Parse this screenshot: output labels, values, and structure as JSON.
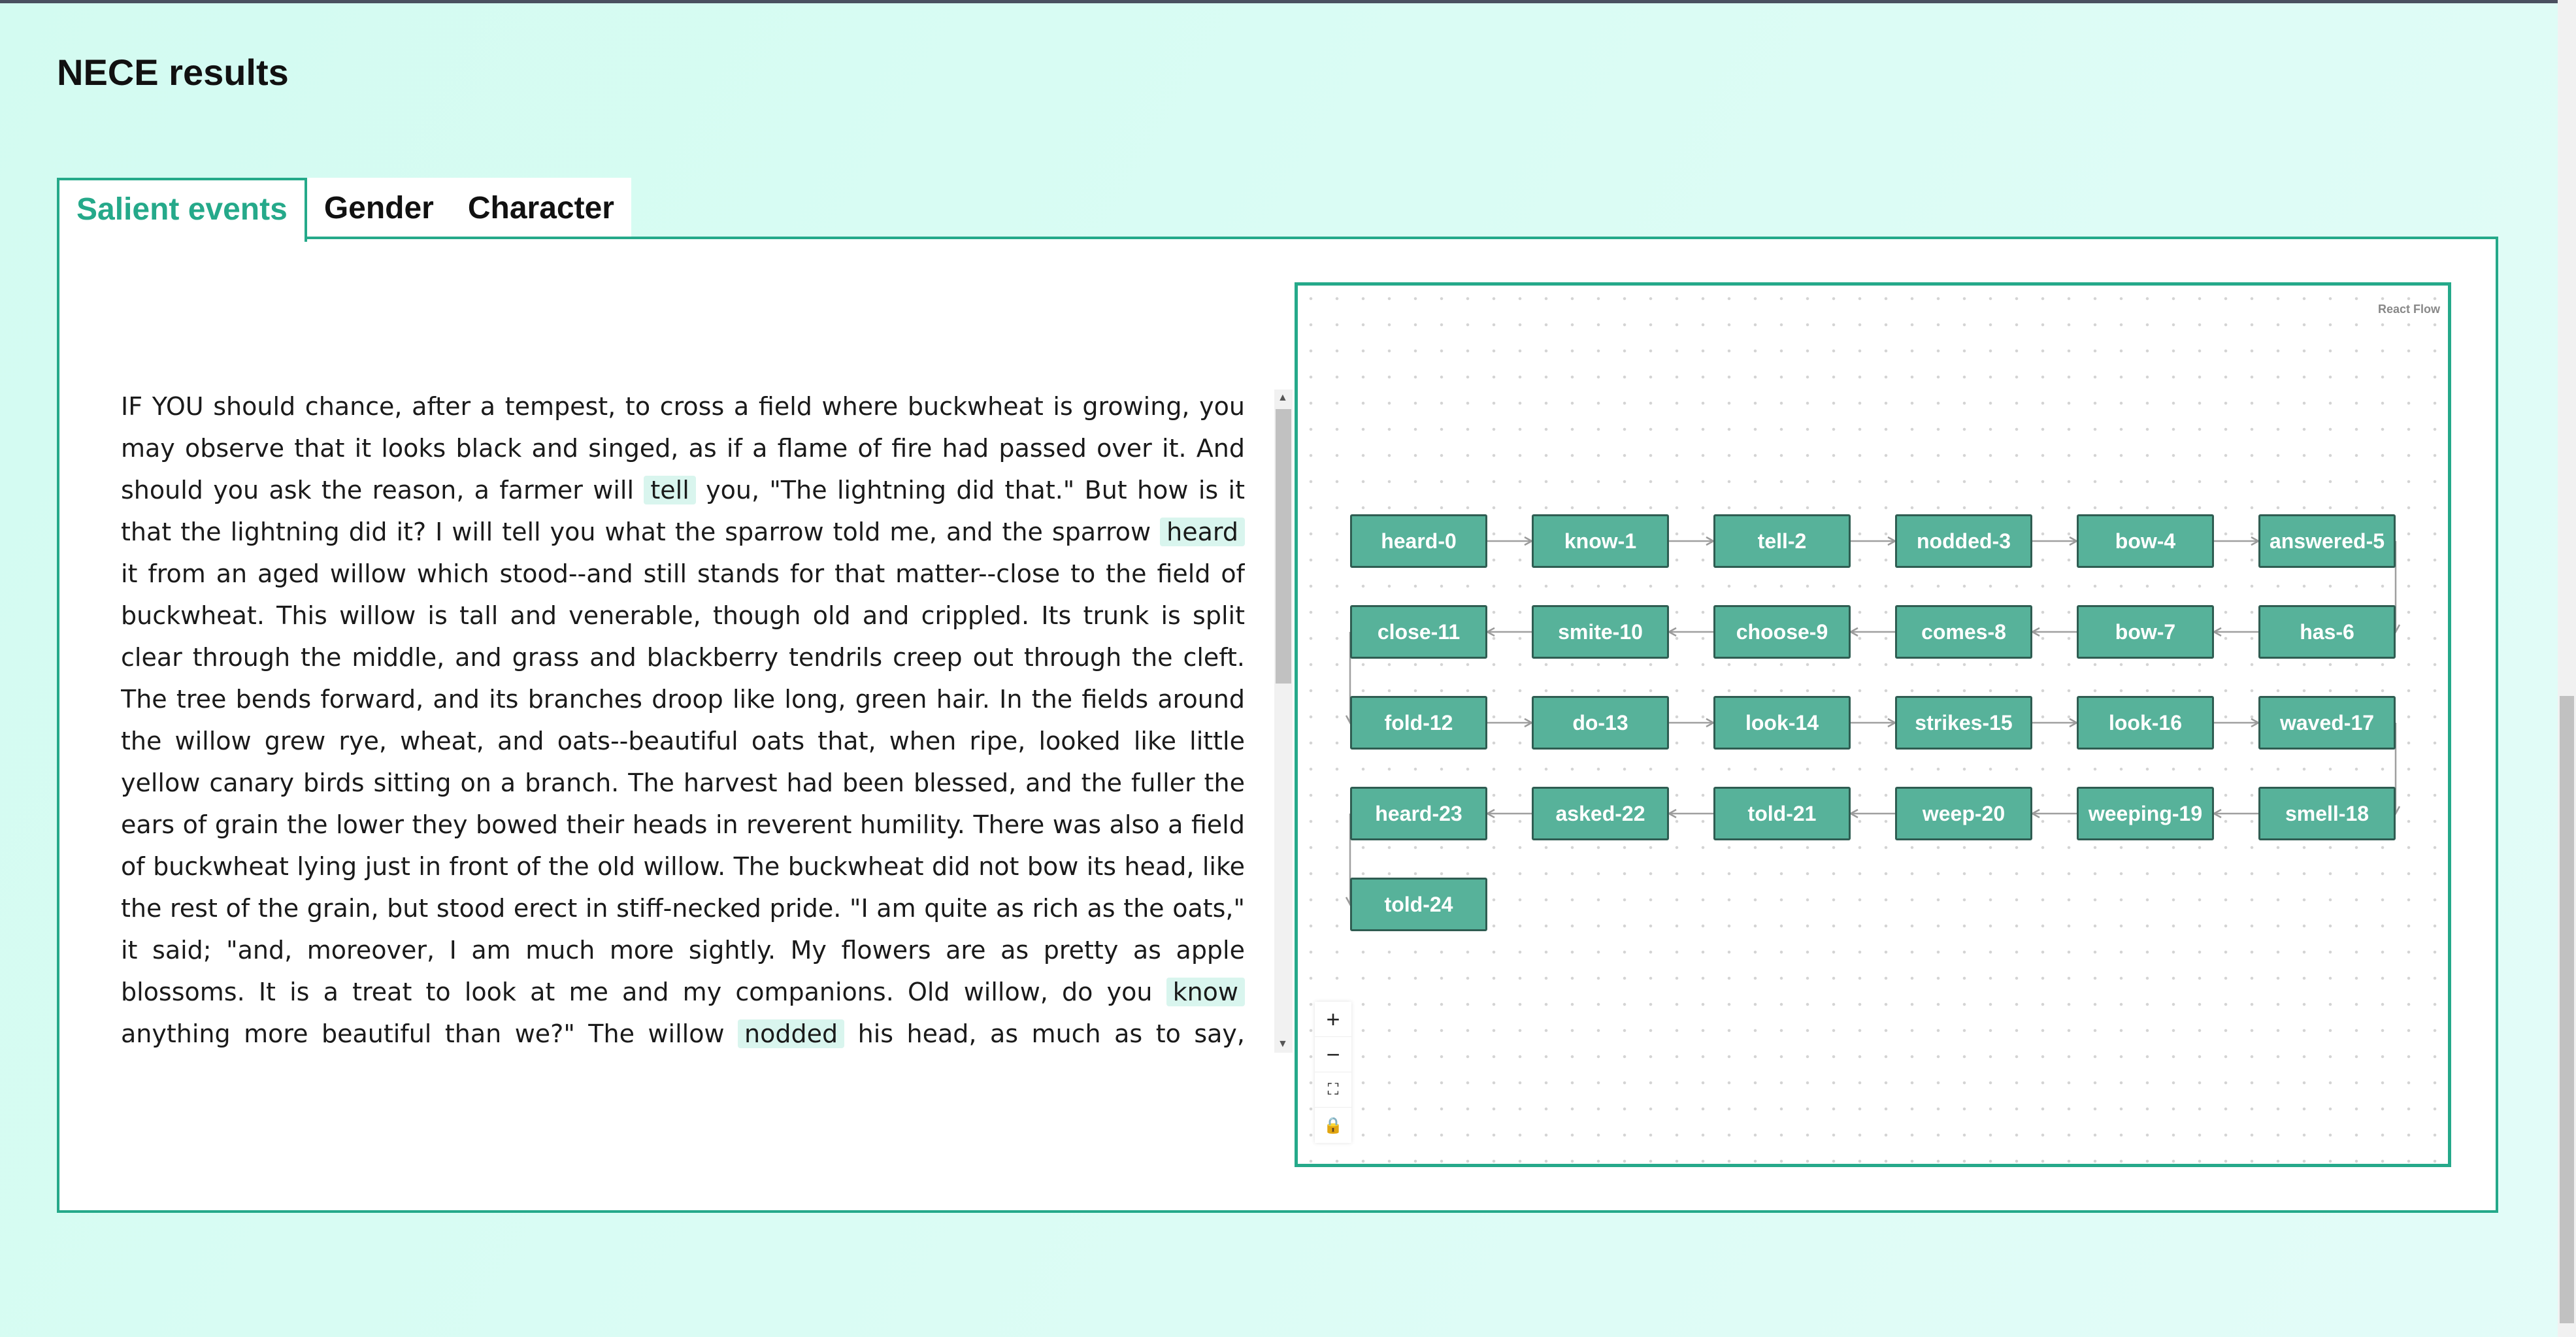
{
  "page": {
    "title": "NECE results"
  },
  "tabs": [
    {
      "label": "Salient events",
      "active": true
    },
    {
      "label": "Gender",
      "active": false
    },
    {
      "label": "Character",
      "active": false
    }
  ],
  "story": {
    "segments": [
      {
        "text": "IF YOU should chance, after a tempest, to cross a field where buckwheat is growing, you may observe that it looks black and singed, as if a flame of fire had passed over it. And should you ask the reason, a farmer will "
      },
      {
        "text": "tell",
        "highlight": true
      },
      {
        "text": " you, \"The lightning did that.\" But how is it that the lightning did it? I will tell you what the sparrow told me, and the sparrow "
      },
      {
        "text": "heard",
        "highlight": true
      },
      {
        "text": " it from an aged willow which stood--and still stands for that matter--close to the field of buckwheat. This willow is tall and venerable, though old and crippled. Its trunk is split clear through the middle, and grass and blackberry tendrils creep out through the cleft. The tree bends forward, and its branches droop like long, green hair. In the fields around the willow grew rye, wheat, and oats--beautiful oats that, when ripe, looked like little yellow canary birds sitting on a branch. The harvest had been blessed, and the fuller the ears of grain the lower they bowed their heads in reverent humility. There was also a field of buckwheat lying just in front of the old willow. The buckwheat did not bow its head, like the rest of the grain, but stood erect in stiff-necked pride. \"I am quite as rich as the oats,\" it said; \"and, moreover, I am much more sightly. My flowers are as pretty as apple blossoms. It is a treat to look at me and my companions. Old willow, do you "
      },
      {
        "text": "know",
        "highlight": true
      },
      {
        "text": " anything more beautiful than we?\" The willow "
      },
      {
        "text": "nodded",
        "highlight": true
      },
      {
        "text": " his head, as much as to say, \"Indeed I do!\" But the buckwheat was so puffed with pride that it only said: \"The stupid tree! He is so old that grass is growing out of his body.\" Now there came on a dreadful storm, and the flowers of the field folded their leaves together and bowed their little heads while the storm passed over them."
      }
    ]
  },
  "flow": {
    "attribution": "React Flow",
    "nodes": [
      "heard-0",
      "know-1",
      "tell-2",
      "nodded-3",
      "bow-4",
      "answered-5",
      "has-6",
      "bow-7",
      "comes-8",
      "choose-9",
      "smite-10",
      "close-11",
      "fold-12",
      "do-13",
      "look-14",
      "strikes-15",
      "look-16",
      "waved-17",
      "smell-18",
      "weeping-19",
      "weep-20",
      "told-21",
      "asked-22",
      "heard-23",
      "told-24"
    ],
    "controls": [
      {
        "name": "zoom-in-button",
        "icon": "+"
      },
      {
        "name": "zoom-out-button",
        "icon": "−"
      },
      {
        "name": "fit-view-button",
        "icon": "⛶"
      },
      {
        "name": "lock-button",
        "icon": "🔒"
      }
    ]
  }
}
